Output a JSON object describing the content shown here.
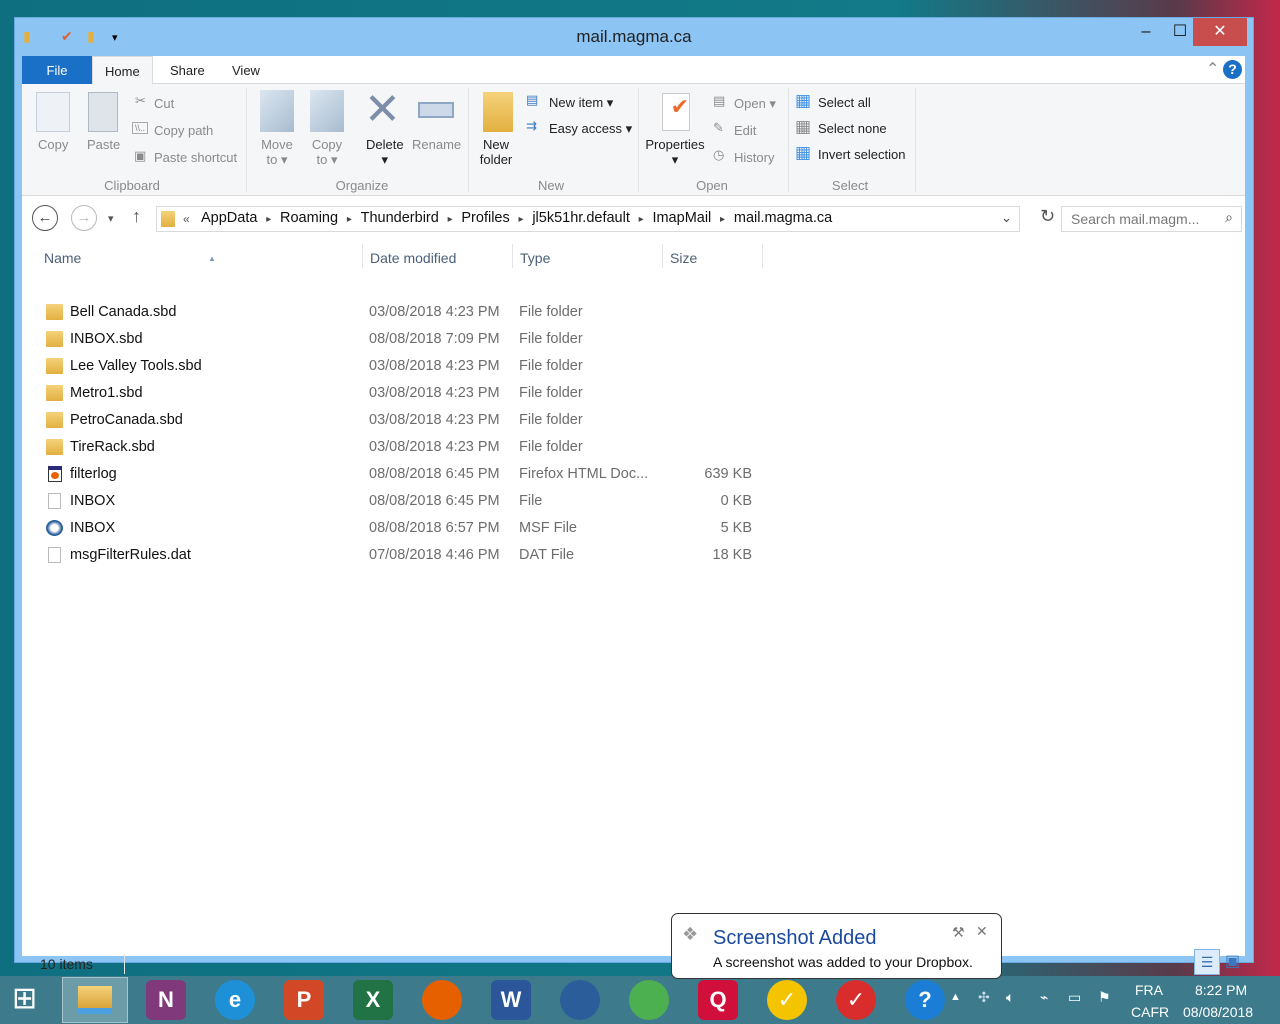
{
  "window": {
    "title": "mail.magma.ca",
    "minimize": "–",
    "maximize": "☐",
    "close": "✕"
  },
  "ribbon_tabs": [
    {
      "label": "File"
    },
    {
      "label": "Home"
    },
    {
      "label": "Share"
    },
    {
      "label": "View"
    }
  ],
  "ribbon": {
    "clipboard": {
      "group": "Clipboard",
      "copy": "Copy",
      "paste": "Paste",
      "cut": "Cut",
      "copy_path": "Copy path",
      "paste_shortcut": "Paste shortcut"
    },
    "organize": {
      "group": "Organize",
      "move_to": "Move",
      "move_to2": "to",
      "copy_to": "Copy",
      "copy_to2": "to",
      "delete": "Delete",
      "rename": "Rename"
    },
    "new": {
      "group": "New",
      "new_folder": "New",
      "new_folder2": "folder",
      "new_item": "New item",
      "easy_access": "Easy access"
    },
    "open": {
      "group": "Open",
      "properties": "Properties",
      "open": "Open",
      "edit": "Edit",
      "history": "History"
    },
    "select": {
      "group": "Select",
      "select_all": "Select all",
      "select_none": "Select none",
      "invert": "Invert selection"
    }
  },
  "breadcrumb": [
    "AppData",
    "Roaming",
    "Thunderbird",
    "Profiles",
    "jl5k51hr.default",
    "ImapMail",
    "mail.magma.ca"
  ],
  "search": {
    "placeholder": "Search mail.magm..."
  },
  "columns": {
    "name": "Name",
    "date": "Date modified",
    "type": "Type",
    "size": "Size"
  },
  "files": [
    {
      "name": "Bell Canada.sbd",
      "date": "03/08/2018 4:23 PM",
      "type": "File folder",
      "size": "",
      "icon": "folder"
    },
    {
      "name": "INBOX.sbd",
      "date": "08/08/2018 7:09 PM",
      "type": "File folder",
      "size": "",
      "icon": "folder"
    },
    {
      "name": "Lee Valley Tools.sbd",
      "date": "03/08/2018 4:23 PM",
      "type": "File folder",
      "size": "",
      "icon": "folder"
    },
    {
      "name": "Metro1.sbd",
      "date": "03/08/2018 4:23 PM",
      "type": "File folder",
      "size": "",
      "icon": "folder"
    },
    {
      "name": "PetroCanada.sbd",
      "date": "03/08/2018 4:23 PM",
      "type": "File folder",
      "size": "",
      "icon": "folder"
    },
    {
      "name": "TireRack.sbd",
      "date": "03/08/2018 4:23 PM",
      "type": "File folder",
      "size": "",
      "icon": "folder"
    },
    {
      "name": "filterlog",
      "date": "08/08/2018 6:45 PM",
      "type": "Firefox HTML Doc...",
      "size": "639 KB",
      "icon": "firefox"
    },
    {
      "name": "INBOX",
      "date": "08/08/2018 6:45 PM",
      "type": "File",
      "size": "0 KB",
      "icon": "file"
    },
    {
      "name": "INBOX",
      "date": "08/08/2018 6:57 PM",
      "type": "MSF File",
      "size": "5 KB",
      "icon": "thunderbird"
    },
    {
      "name": "msgFilterRules.dat",
      "date": "07/08/2018 4:46 PM",
      "type": "DAT File",
      "size": "18 KB",
      "icon": "file"
    }
  ],
  "status": {
    "items": "10 items"
  },
  "toast": {
    "title": "Screenshot Added",
    "body": "A screenshot was added to your Dropbox."
  },
  "taskbar": {
    "apps": [
      {
        "name": "File Explorer",
        "glyph": ""
      },
      {
        "name": "OneNote",
        "glyph": "N",
        "color": "#80397b"
      },
      {
        "name": "Internet Explorer",
        "glyph": "e",
        "color": "#1e90d8"
      },
      {
        "name": "PowerPoint",
        "glyph": "P",
        "color": "#d24726"
      },
      {
        "name": "Excel",
        "glyph": "X",
        "color": "#217346"
      },
      {
        "name": "Firefox",
        "glyph": "",
        "color": "#e66000"
      },
      {
        "name": "Word",
        "glyph": "W",
        "color": "#2b579a"
      },
      {
        "name": "Thunderbird",
        "glyph": "",
        "color": "#2a5d9a"
      },
      {
        "name": "Chrome",
        "glyph": "",
        "color": "#4caf50"
      },
      {
        "name": "Q",
        "glyph": "Q",
        "color": "#d0103a"
      },
      {
        "name": "Norton",
        "glyph": "✓",
        "color": "#f5c400"
      },
      {
        "name": "Todo",
        "glyph": "✓",
        "color": "#d92c2c"
      },
      {
        "name": "Help",
        "glyph": "?",
        "color": "#1b7dd6"
      }
    ],
    "lang1": "FRA",
    "lang2": "CAFR",
    "time": "8:22 PM",
    "date": "08/08/2018"
  }
}
